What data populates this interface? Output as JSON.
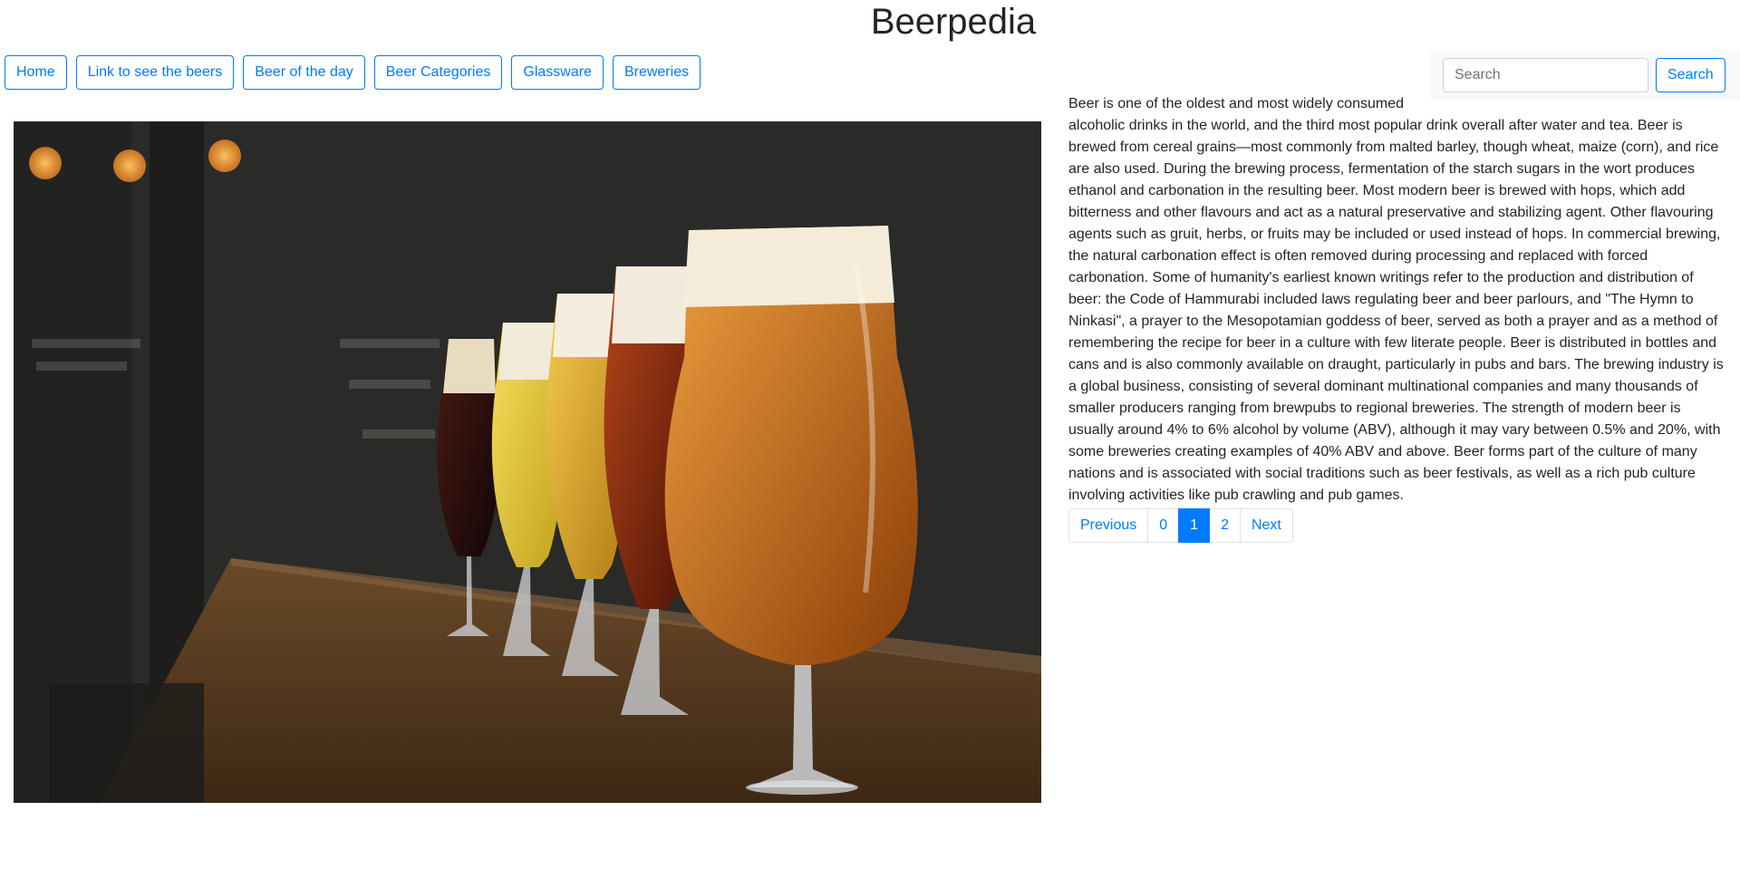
{
  "site": {
    "title": "Beerpedia"
  },
  "nav": {
    "items": [
      {
        "label": "Home"
      },
      {
        "label": "Link to see the beers"
      },
      {
        "label": "Beer of the day"
      },
      {
        "label": "Beer Categories"
      },
      {
        "label": "Glassware"
      },
      {
        "label": "Breweries"
      }
    ]
  },
  "search": {
    "placeholder": "Search",
    "value": "",
    "button_label": "Search"
  },
  "hero": {
    "image": "beer glasses on bar counter"
  },
  "article": {
    "lead": "Beer is one of the oldest and most widely consumed",
    "body": "alcoholic drinks in the world, and the third most popular drink overall after water and tea. Beer is brewed from cereal grains—most commonly from malted barley, though wheat, maize (corn), and rice are also used. During the brewing process, fermentation of the starch sugars in the wort produces ethanol and carbonation in the resulting beer. Most modern beer is brewed with hops, which add bitterness and other flavours and act as a natural preservative and stabilizing agent. Other flavouring agents such as gruit, herbs, or fruits may be included or used instead of hops. In commercial brewing, the natural carbonation effect is often removed during processing and replaced with forced carbonation. Some of humanity's earliest known writings refer to the production and distribution of beer: the Code of Hammurabi included laws regulating beer and beer parlours, and \"The Hymn to Ninkasi\", a prayer to the Mesopotamian goddess of beer, served as both a prayer and as a method of remembering the recipe for beer in a culture with few literate people. Beer is distributed in bottles and cans and is also commonly available on draught, particularly in pubs and bars. The brewing industry is a global business, consisting of several dominant multinational companies and many thousands of smaller producers ranging from brewpubs to regional breweries. The strength of modern beer is usually around 4% to 6% alcohol by volume (ABV), although it may vary between 0.5% and 20%, with some breweries creating examples of 40% ABV and above. Beer forms part of the culture of many nations and is associated with social traditions such as beer festivals, as well as a rich pub culture involving activities like pub crawling and pub games."
  },
  "pagination": {
    "previous": "Previous",
    "pages": [
      "0",
      "1",
      "2"
    ],
    "current": "1",
    "next": "Next"
  },
  "colors": {
    "primary": "#007bff",
    "text": "#212529"
  }
}
